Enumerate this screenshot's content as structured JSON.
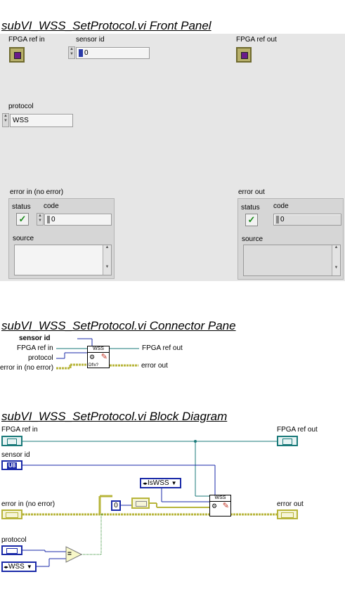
{
  "front_panel": {
    "title": "subVI_WSS_SetProtocol.vi Front Panel",
    "fpga_ref_in_label": "FPGA ref in",
    "sensor_id_label": "sensor id",
    "sensor_id_value": "0",
    "fpga_ref_out_label": "FPGA ref out",
    "protocol_label": "protocol",
    "protocol_value": "WSS",
    "error_in": {
      "label": "error in (no error)",
      "status_label": "status",
      "code_label": "code",
      "code_value": "0",
      "source_label": "source"
    },
    "error_out": {
      "label": "error out",
      "status_label": "status",
      "code_label": "code",
      "code_value": "0",
      "source_label": "source"
    }
  },
  "connector_pane": {
    "title": "subVI_WSS_SetProtocol.vi Connector Pane",
    "sensor_id": "sensor id",
    "fpga_ref_in": "FPGA ref in",
    "protocol": "protocol",
    "error_in": "error in (no error)",
    "fpga_ref_out": "FPGA ref out",
    "error_out": "error out",
    "icon_text_top": "WSS",
    "icon_text_bottom": "Df!x?"
  },
  "block_diagram": {
    "title": "subVI_WSS_SetProtocol.vi Block Diagram",
    "fpga_ref_in": "FPGA ref in",
    "fpga_ref_out": "FPGA ref out",
    "sensor_id": "sensor id",
    "sensor_id_type": "U8",
    "error_in": "error in (no error)",
    "error_out": "error out",
    "protocol": "protocol",
    "enum_iswss": "IsWSS",
    "constant_zero": "0",
    "enum_wss": "WSS",
    "equals_symbol": "=",
    "subvi_text": "WSS"
  },
  "colors": {
    "panel_bg": "#e6e6e6",
    "refnum_wire": "#1a7a7a",
    "numeric_wire": "#1a2aa8",
    "error_wire": "#b7b43a",
    "enum_wire": "#1a2aa8",
    "boolean_check": "#1a8a1a"
  }
}
